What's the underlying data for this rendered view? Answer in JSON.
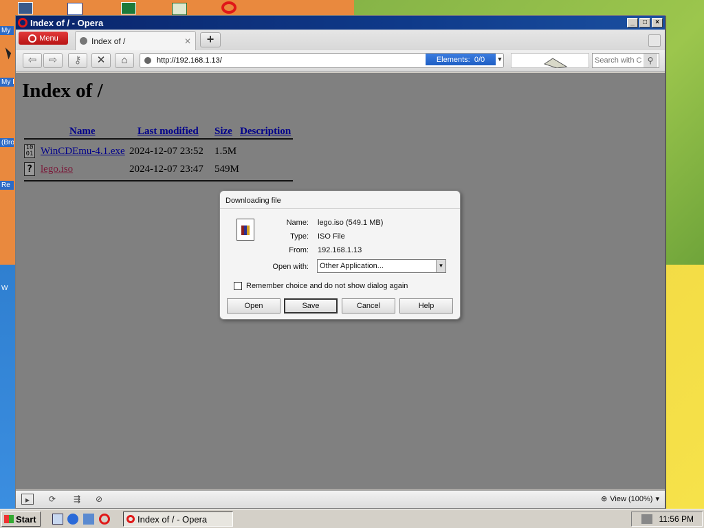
{
  "desktop": {
    "labels": [
      "My",
      "My I",
      "(Bro",
      "Re",
      "W"
    ]
  },
  "window": {
    "title": "Index of / - Opera"
  },
  "tabbar": {
    "menu_label": "Menu",
    "tab_title": "Index of /",
    "new_tab": "+"
  },
  "navbar": {
    "url": "http://192.168.1.13/",
    "elements_label": "Elements:",
    "elements_count": "0/0",
    "search_placeholder": "Search with Co"
  },
  "page": {
    "heading": "Index of /",
    "columns": [
      "Name",
      "Last modified",
      "Size",
      "Description"
    ],
    "files": [
      {
        "name": "WinCDEmu-4.1.exe",
        "modified": "2024-12-07 23:52",
        "size": "1.5M"
      },
      {
        "name": "lego.iso",
        "modified": "2024-12-07 23:47",
        "size": "549M"
      }
    ]
  },
  "dialog": {
    "title": "Downloading file",
    "name_label": "Name:",
    "name_value": "lego.iso (549.1 MB)",
    "type_label": "Type:",
    "type_value": "ISO File",
    "from_label": "From:",
    "from_value": "192.168.1.13",
    "open_with_label": "Open with:",
    "open_with_value": "Other Application...",
    "remember_label": "Remember choice and do not show dialog again",
    "buttons": [
      "Open",
      "Save",
      "Cancel",
      "Help"
    ]
  },
  "statusbar": {
    "view_label": "View (100%)"
  },
  "taskbar": {
    "start_label": "Start",
    "task_label": "Index of / - Opera",
    "clock": "11:56 PM"
  }
}
